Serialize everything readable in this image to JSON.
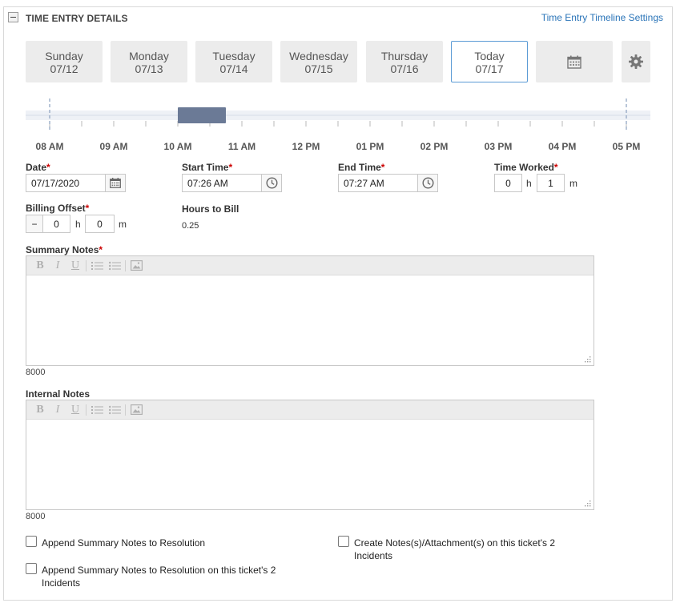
{
  "section": {
    "title": "TIME ENTRY DETAILS",
    "settings_link": "Time Entry Timeline Settings"
  },
  "days": [
    {
      "name": "Sunday",
      "date": "07/12"
    },
    {
      "name": "Monday",
      "date": "07/13"
    },
    {
      "name": "Tuesday",
      "date": "07/14"
    },
    {
      "name": "Wednesday",
      "date": "07/15"
    },
    {
      "name": "Thursday",
      "date": "07/16"
    },
    {
      "name": "Today",
      "date": "07/17"
    }
  ],
  "timeline": {
    "hours": [
      "08 AM",
      "09 AM",
      "10 AM",
      "11 AM",
      "12 PM",
      "01 PM",
      "02 PM",
      "03 PM",
      "04 PM",
      "05 PM"
    ],
    "selection_start_hour": 10.0,
    "selection_end_hour": 10.75
  },
  "form": {
    "date_label": "Date",
    "date_value": "07/17/2020",
    "start_label": "Start Time",
    "start_value": "07:26 AM",
    "end_label": "End Time",
    "end_value": "07:27 AM",
    "worked_label": "Time Worked",
    "worked_hours": "0",
    "worked_minutes": "1",
    "h_unit": "h",
    "m_unit": "m",
    "offset_label": "Billing Offset",
    "offset_sign": "−",
    "offset_hours": "0",
    "offset_minutes": "0",
    "hours_to_bill_label": "Hours to Bill",
    "hours_to_bill_value": "0.25",
    "required_mark": "*"
  },
  "summary_notes": {
    "label": "Summary Notes",
    "counter": "8000"
  },
  "internal_notes": {
    "label": "Internal Notes",
    "counter": "8000"
  },
  "toolbar": {
    "bold": "B",
    "italic": "I",
    "underline": "U"
  },
  "checkboxes": {
    "append_summary": "Append Summary Notes to Resolution",
    "create_notes_line1": "Create Notes(s)/Attachment(s) on this ticket's 2",
    "create_notes_line2": "Incidents",
    "append_incidents_line1": "Append Summary Notes to Resolution on this ticket's 2",
    "append_incidents_line2": "Incidents"
  }
}
